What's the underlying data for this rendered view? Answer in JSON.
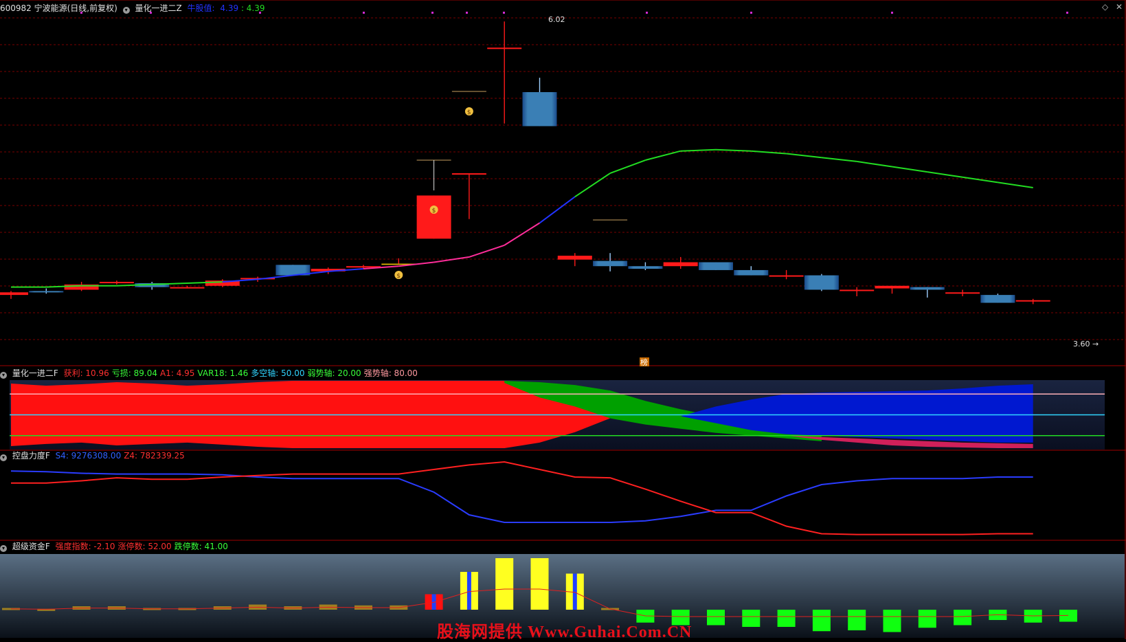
{
  "main_header": {
    "stock": "600982 宁波能源(日线,前复权)",
    "indicator": "量化一进二Z",
    "buy_label": "牛股值:",
    "buy_val": "4.39",
    "sep_val": ": 4.39"
  },
  "price_labels": {
    "high": "6.02",
    "last": "3.60"
  },
  "special_marker": "榜",
  "panel2_header": {
    "name": "量化一进二F",
    "items": [
      {
        "label": "获利: 10.96",
        "color": "#ff3030"
      },
      {
        "label": "亏损: 89.04",
        "color": "#39ff39"
      },
      {
        "label": "A1: 4.95",
        "color": "#ff3030"
      },
      {
        "label": "VAR18: 1.46",
        "color": "#39ff39"
      },
      {
        "label": "多空轴: 50.00",
        "color": "#30d5ff"
      },
      {
        "label": "弱势轴: 20.00",
        "color": "#39ff39"
      },
      {
        "label": "强势轴: 80.00",
        "color": "#ff9aa0"
      }
    ]
  },
  "panel3_header": {
    "name": "控盘力度F",
    "items": [
      {
        "label": "S4: 9276308.00",
        "color": "#3060ff"
      },
      {
        "label": "Z4: 782339.25",
        "color": "#ff3030"
      }
    ]
  },
  "panel4_header": {
    "name": "超级资金F",
    "items": [
      {
        "label": "强度指数: -2.10",
        "color": "#ff3030"
      },
      {
        "label": "涨停数: 52.00",
        "color": "#ff3030"
      },
      {
        "label": "跌停数: 41.00",
        "color": "#39ff39"
      }
    ]
  },
  "watermark": "股海网提供 Www.Guhai.Com.CN",
  "colors": {
    "up": "#ff1a1a",
    "down": "#3a7fb5",
    "limit_up": "#f0c000",
    "grid": "#7a0000",
    "ma_green": "#22dd22",
    "ma_blue": "#2233ff",
    "ma_magenta": "#ff2d9a"
  },
  "chart_data": [
    {
      "type": "candlestick",
      "title": "600982 宁波能源(日线,前复权)",
      "ylim": [
        3.4,
        6.1
      ],
      "candles": [
        {
          "o": 3.93,
          "h": 3.96,
          "l": 3.9,
          "c": 3.95
        },
        {
          "o": 3.96,
          "h": 3.98,
          "l": 3.94,
          "c": 3.95
        },
        {
          "o": 3.97,
          "h": 4.03,
          "l": 3.96,
          "c": 4.01
        },
        {
          "o": 4.02,
          "h": 4.04,
          "l": 4.01,
          "c": 4.03
        },
        {
          "o": 4.02,
          "h": 4.03,
          "l": 3.97,
          "c": 3.99
        },
        {
          "o": 3.99,
          "h": 4.0,
          "l": 3.98,
          "c": 3.99
        },
        {
          "o": 4.0,
          "h": 4.05,
          "l": 3.99,
          "c": 4.04
        },
        {
          "o": 4.05,
          "h": 4.07,
          "l": 4.03,
          "c": 4.06
        },
        {
          "o": 4.16,
          "h": 4.16,
          "l": 4.08,
          "c": 4.08
        },
        {
          "o": 4.11,
          "h": 4.14,
          "l": 4.09,
          "c": 4.13
        },
        {
          "o": 4.15,
          "h": 4.16,
          "l": 4.13,
          "c": 4.15
        },
        {
          "o": 4.17,
          "h": 4.21,
          "l": 4.16,
          "c": 4.17
        },
        {
          "o": 4.36,
          "h": 4.69,
          "l": 4.36,
          "c": 4.69
        },
        {
          "o": 4.86,
          "h": 4.86,
          "l": 4.51,
          "c": 4.86
        },
        {
          "o": 5.82,
          "h": 6.02,
          "l": 5.24,
          "c": 5.82
        },
        {
          "o": 5.48,
          "h": 5.59,
          "l": 5.22,
          "c": 5.22
        },
        {
          "o": 4.2,
          "h": 4.25,
          "l": 4.15,
          "c": 4.23
        },
        {
          "o": 4.19,
          "h": 4.25,
          "l": 4.11,
          "c": 4.15
        },
        {
          "o": 4.15,
          "h": 4.18,
          "l": 4.12,
          "c": 4.13
        },
        {
          "o": 4.15,
          "h": 4.22,
          "l": 4.13,
          "c": 4.18
        },
        {
          "o": 4.18,
          "h": 4.18,
          "l": 4.12,
          "c": 4.12
        },
        {
          "o": 4.12,
          "h": 4.15,
          "l": 4.08,
          "c": 4.08
        },
        {
          "o": 4.08,
          "h": 4.12,
          "l": 4.05,
          "c": 4.08
        },
        {
          "o": 4.08,
          "h": 4.09,
          "l": 3.96,
          "c": 3.97
        },
        {
          "o": 3.96,
          "h": 3.99,
          "l": 3.92,
          "c": 3.97
        },
        {
          "o": 3.98,
          "h": 4.0,
          "l": 3.94,
          "c": 4.0
        },
        {
          "o": 3.99,
          "h": 3.99,
          "l": 3.91,
          "c": 3.97
        },
        {
          "o": 3.95,
          "h": 3.97,
          "l": 3.92,
          "c": 3.95
        },
        {
          "o": 3.93,
          "h": 3.94,
          "l": 3.87,
          "c": 3.87
        },
        {
          "o": 3.88,
          "h": 3.9,
          "l": 3.86,
          "c": 3.89
        }
      ],
      "limit_up_candle": 11,
      "moving_average": [
        3.99,
        3.99,
        4.0,
        4.0,
        4.01,
        4.02,
        4.03,
        4.05,
        4.08,
        4.11,
        4.13,
        4.15,
        4.18,
        4.22,
        4.31,
        4.48,
        4.68,
        4.86,
        4.96,
        5.03,
        5.04,
        5.03,
        5.01,
        4.98,
        4.95,
        4.91,
        4.87,
        4.83,
        4.79,
        4.75
      ]
    },
    {
      "type": "area",
      "title": "量化一进二F",
      "ylim": [
        0,
        100
      ],
      "lines": {
        "strong_axis": 80,
        "bull_bear_axis": 50,
        "weak_axis": 20
      }
    },
    {
      "type": "line",
      "title": "控盘力度F",
      "series": [
        {
          "name": "S4",
          "values": [
            88,
            87,
            85,
            84,
            84,
            84,
            83,
            80,
            78,
            78,
            78,
            78,
            60,
            30,
            20,
            20,
            20,
            20,
            22,
            28,
            36,
            36,
            55,
            70,
            75,
            78,
            78,
            78,
            80,
            80
          ]
        },
        {
          "name": "Z4",
          "values": [
            72,
            72,
            75,
            79,
            77,
            77,
            80,
            82,
            84,
            84,
            84,
            84,
            90,
            96,
            100,
            90,
            80,
            79,
            64,
            48,
            33,
            33,
            15,
            5,
            4,
            4,
            4,
            4,
            5,
            5
          ]
        }
      ]
    },
    {
      "type": "bar",
      "title": "超级资金F",
      "values": [
        2,
        1,
        4,
        4,
        2,
        2,
        4,
        6,
        4,
        6,
        5,
        5,
        18,
        44,
        60,
        60,
        42,
        2,
        -15,
        -18,
        -18,
        -20,
        -20,
        -25,
        -24,
        -26,
        -21,
        -18,
        -12,
        -15,
        -14
      ]
    }
  ]
}
